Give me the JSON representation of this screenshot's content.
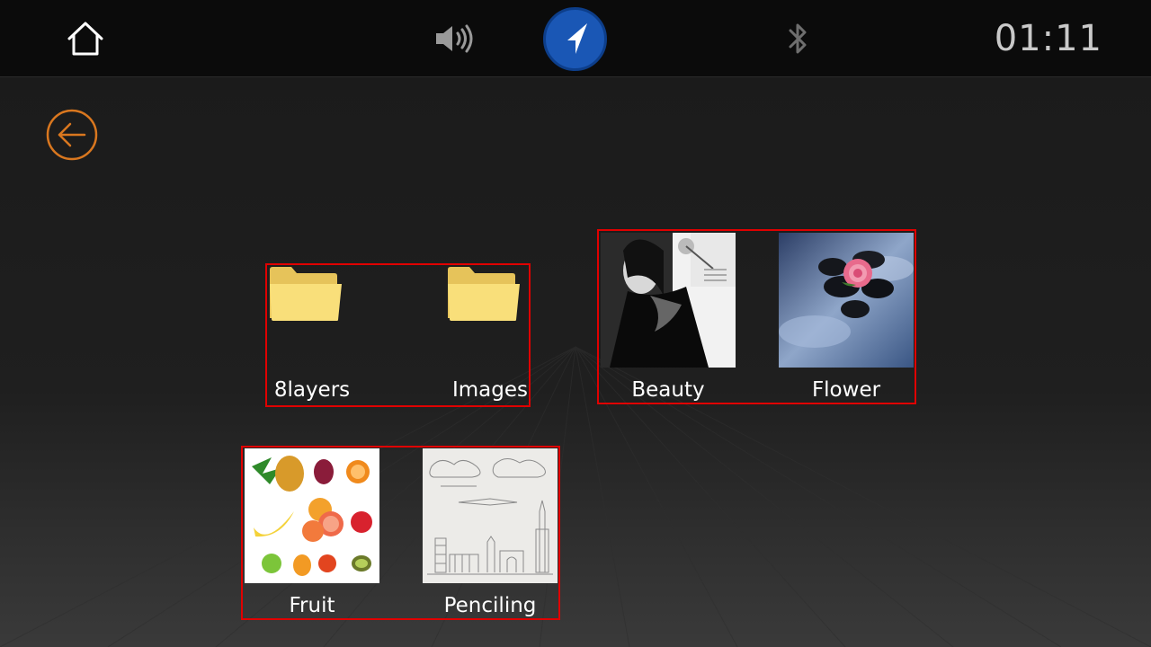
{
  "status_bar": {
    "home_icon": "home-icon",
    "volume_icon": "volume-icon",
    "navigation_icon": "navigation-arrow-icon",
    "bluetooth_icon": "bluetooth-icon",
    "time": "01:11",
    "nav_color": "#1a57b5"
  },
  "toolbar": {
    "back_icon": "back-arrow-icon",
    "back_color": "#d9771f"
  },
  "gallery": {
    "folders": [
      {
        "label": "8layers",
        "icon": "folder-icon"
      },
      {
        "label": "Images",
        "icon": "folder-icon"
      }
    ],
    "photos": [
      {
        "label": "Beauty"
      },
      {
        "label": "Flower"
      },
      {
        "label": "Fruit"
      },
      {
        "label": "Penciling"
      }
    ],
    "highlight_color": "#e00000"
  }
}
